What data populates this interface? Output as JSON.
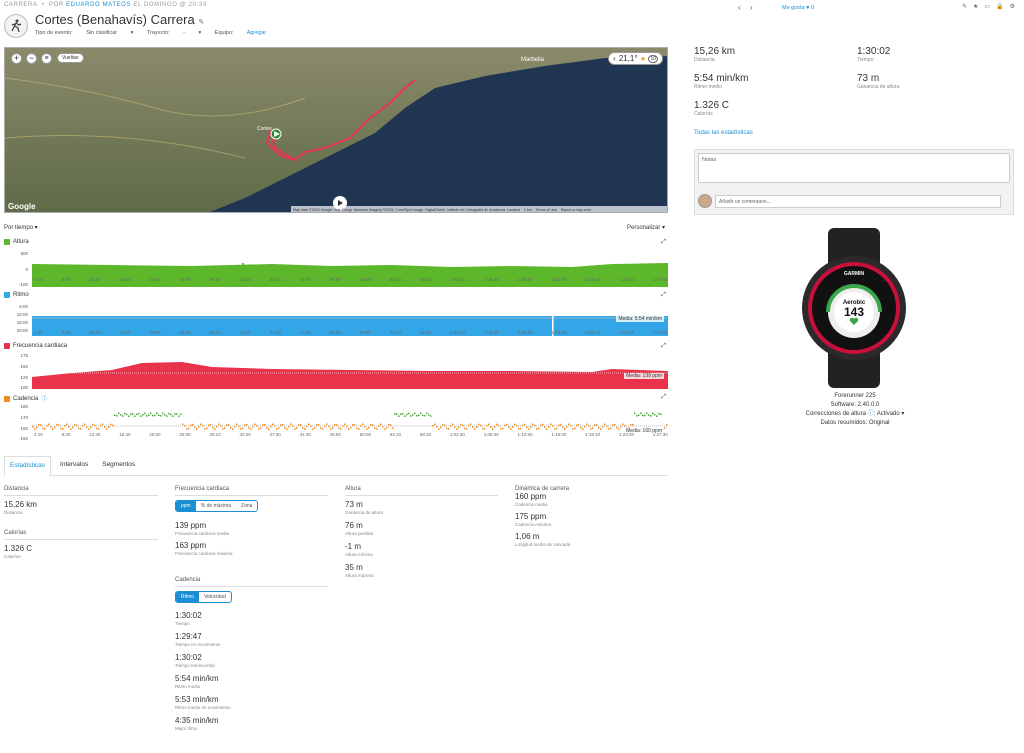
{
  "header": {
    "category": "CARRERA",
    "by": "POR",
    "author": "EDUARDO MATEOS",
    "when": "EL DOMINGO @ 20:33",
    "title": "Cortes (Benahavís) Carrera",
    "event_type_label": "Tipo de evento:",
    "event_type_value": "Sin clasificar",
    "route_label": "Trayecto:",
    "route_value": "-",
    "team_label": "Equipo:",
    "team_value": "Agregar",
    "like_label": "Me gusta",
    "like_count": "0"
  },
  "map": {
    "laps_label": "Vueltas",
    "temperature": "21,1°",
    "attribution": "Map data ©2015 Google, Inst. Geogr. Nacional Imagery ©2015, Cnes/Spot Image, DigitalGlobe, Instituto de Cartografía de Andalucía, Landsat",
    "scale": "1 km",
    "terms": "Terms of Use",
    "report": "Report a map error",
    "google": "Google",
    "city": "Marbella",
    "town": "Cortes"
  },
  "charts": {
    "by_time_label": "Por tiempo",
    "customize_label": "Personalizar",
    "x_ticks": [
      "4:10",
      "8:20",
      "12:30",
      "16:40",
      "20:50",
      "25:00",
      "29:10",
      "33:20",
      "37:30",
      "41:40",
      "45:50",
      "50:00",
      "54:10",
      "58:20",
      "1:02:30",
      "1:06:40",
      "1:10:50",
      "1:15:00",
      "1:19:10",
      "1:23:20",
      "1:27:30"
    ],
    "altitude": {
      "label": "Altura",
      "ticks": [
        "500",
        "0",
        "-100"
      ],
      "color": "#5cb82a"
    },
    "pace": {
      "label": "Ritmo",
      "ticks": [
        "5:00",
        "10:00",
        "15:00",
        "20:00"
      ],
      "color": "#32a6e6",
      "avg": "Media: 5:54 min/km"
    },
    "hr": {
      "label": "Frecuencia cardiaca",
      "ticks": [
        "175",
        "150",
        "125",
        "100"
      ],
      "color": "#e8334a",
      "avg": "Media: 139 ppm"
    },
    "cadence": {
      "label": "Cadencia",
      "ticks": [
        "180",
        "170",
        "160",
        "150"
      ],
      "color": "#f28a1e",
      "avg": "Media: 160 ppm"
    }
  },
  "tabs": [
    "Estadísticas",
    "Intervalos",
    "Segmentos"
  ],
  "stats": {
    "distance": {
      "head": "Distancia",
      "value": "15,26 km",
      "label": "Distancia"
    },
    "calories": {
      "head": "Calorías",
      "value": "1.326 C",
      "label": "Calorías"
    },
    "hr": {
      "head": "Frecuencia cardiaca",
      "seg": [
        "ppm",
        "% de máxima",
        "Zona"
      ],
      "items": [
        {
          "value": "139 ppm",
          "label": "Frecuencia cardiaca media"
        },
        {
          "value": "163 ppm",
          "label": "Frecuencia cardiaca máxima"
        }
      ]
    },
    "pace": {
      "head": "Cadencia",
      "seg": [
        "Ritmo",
        "Velocidad"
      ],
      "items": [
        {
          "value": "1:30:02",
          "label": "Tiempo"
        },
        {
          "value": "1:29:47",
          "label": "Tiempo en movimiento"
        },
        {
          "value": "1:30:02",
          "label": "Tiempo transcurrido"
        },
        {
          "value": "5:54 min/km",
          "label": "Ritmo medio"
        },
        {
          "value": "5:53 min/km",
          "label": "Ritmo medio en movimiento"
        },
        {
          "value": "4:35 min/km",
          "label": "Mejor ritmo"
        }
      ]
    },
    "elevation": {
      "head": "Altura",
      "items": [
        {
          "value": "73 m",
          "label": "Ganancia de altura"
        },
        {
          "value": "76 m",
          "label": "Altura perdida"
        },
        {
          "value": "-1 m",
          "label": "Altura mínima"
        },
        {
          "value": "35 m",
          "label": "Altura máxima"
        }
      ]
    },
    "dynamics": {
      "head": "Dinámica de carrera",
      "items": [
        {
          "value": "160 ppm",
          "label": "Cadencia media"
        },
        {
          "value": "175 ppm",
          "label": "Cadencia máxima"
        },
        {
          "value": "1,06 m",
          "label": "Longitud media de zancada"
        }
      ]
    }
  },
  "summary": [
    {
      "value": "15,26 km",
      "label": "Distancia"
    },
    {
      "value": "1:30:02",
      "label": "Tiempo"
    },
    {
      "value": "5:54 min/km",
      "label": "Ritmo medio"
    },
    {
      "value": "73 m",
      "label": "Ganancia de altura"
    },
    {
      "value": "1.326 C",
      "label": "Calorías"
    }
  ],
  "all_stats_link": "Todas las estadísticas",
  "notes_placeholder": "Notas",
  "comment_placeholder": "Añadir un comentario...",
  "device": {
    "brand": "GARMIN",
    "screen_mode": "Aerobic",
    "screen_value": "143",
    "name": "Forerunner 225",
    "software": "Software: 2.40.0.0",
    "altitude_corr_label": "Correcciones de altura",
    "altitude_corr_value": "Activado",
    "data_summary": "Datos resumidos: Original"
  }
}
